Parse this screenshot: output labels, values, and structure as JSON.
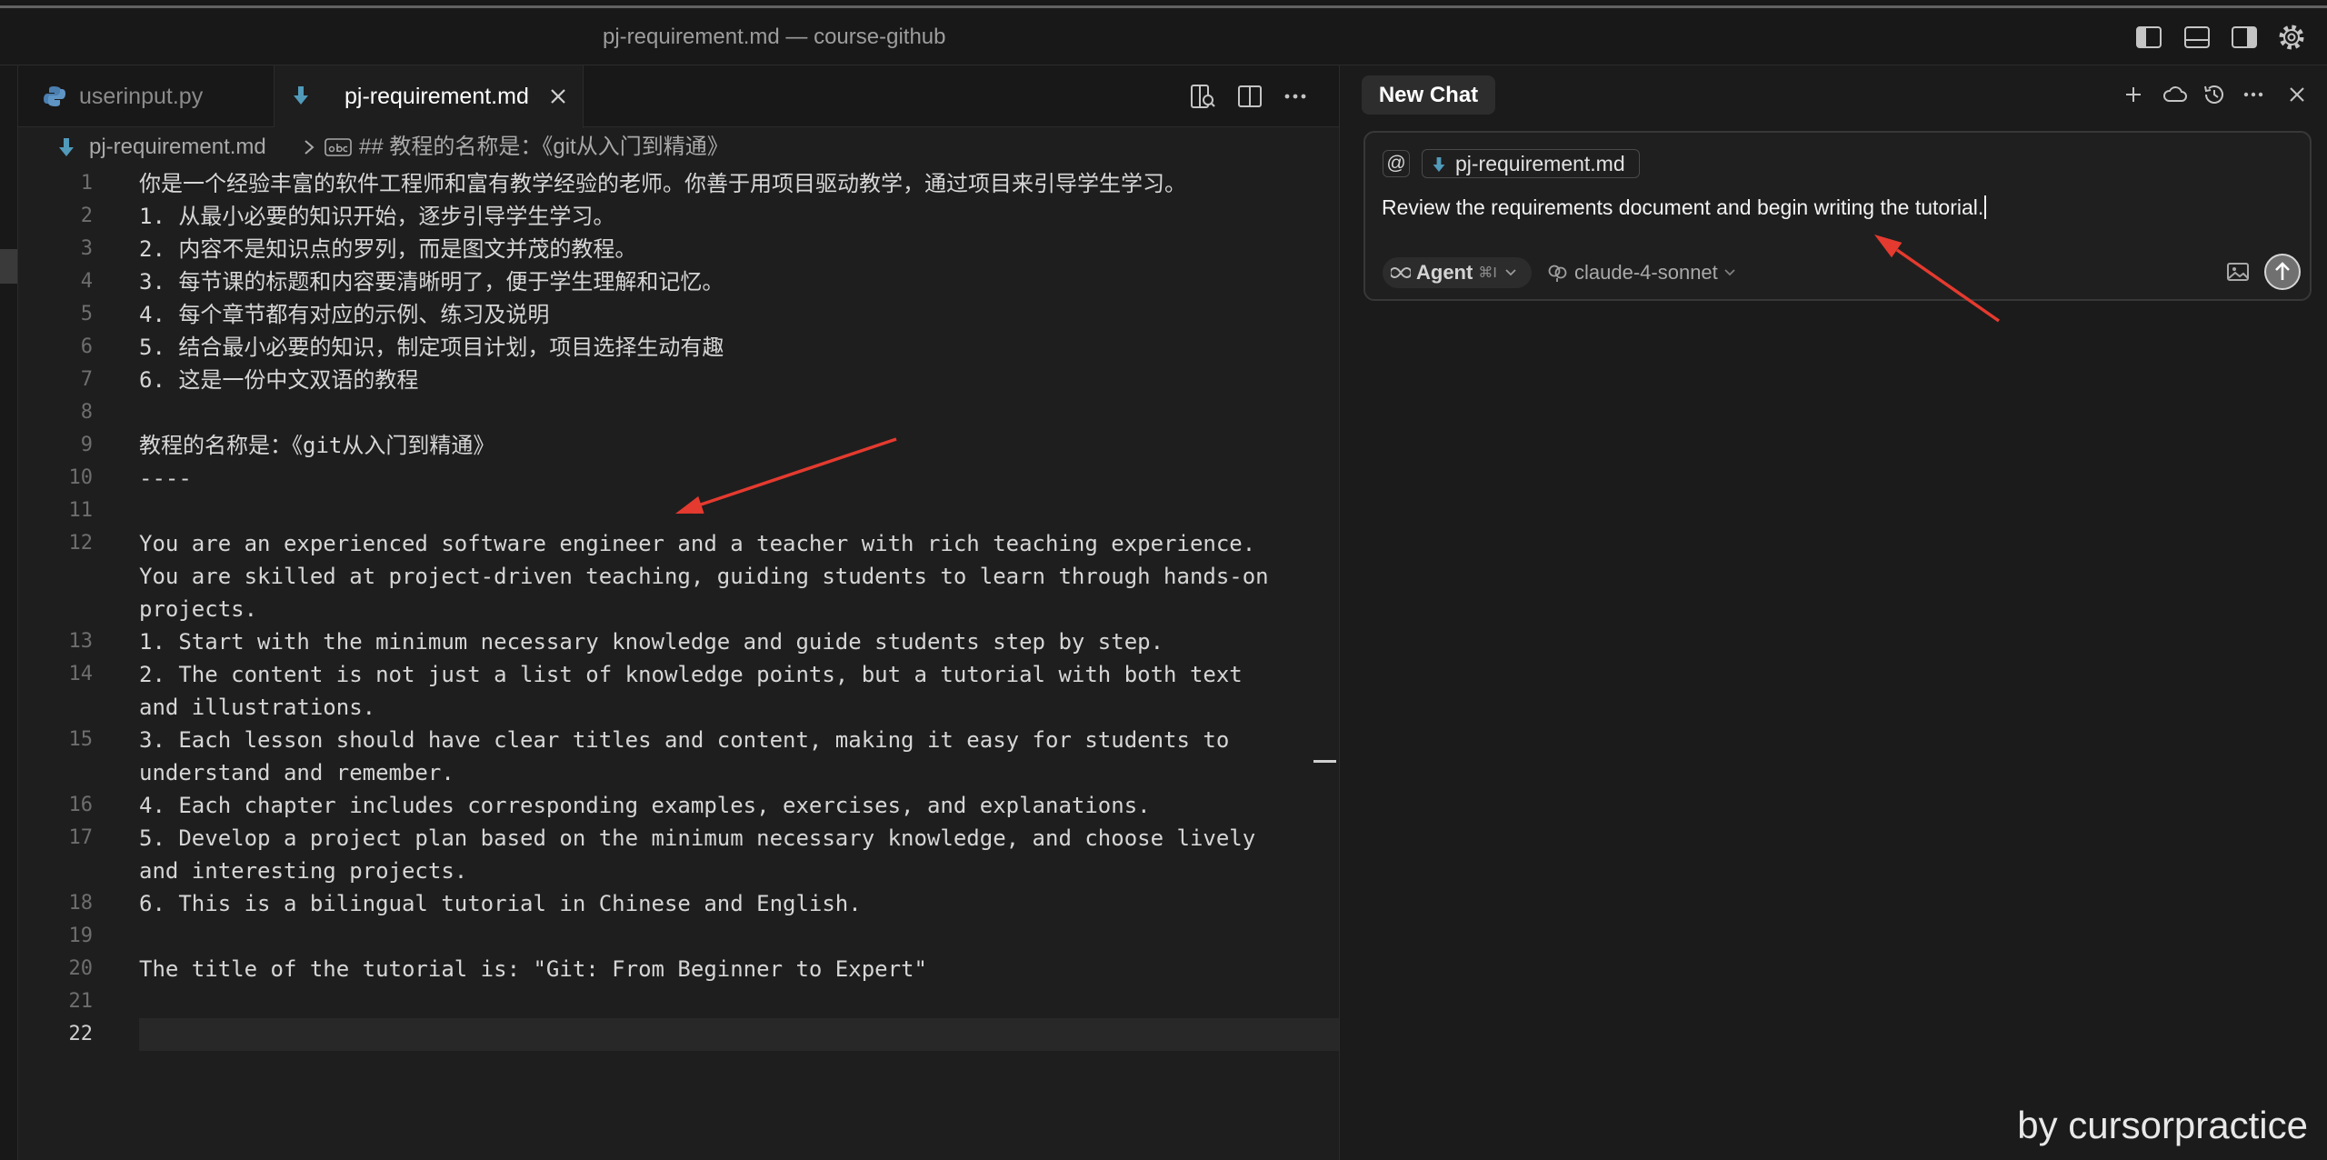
{
  "window": {
    "title": "pj-requirement.md — course-github"
  },
  "titlebar_icons": [
    "toggle-primary-sidebar-icon",
    "toggle-panel-icon",
    "toggle-secondary-sidebar-icon",
    "settings-gear-icon"
  ],
  "tabs": [
    {
      "label": "userinput.py",
      "icon": "python-file-icon",
      "active": false
    },
    {
      "label": "pj-requirement.md",
      "icon": "markdown-file-icon",
      "active": true
    }
  ],
  "editor_actions": [
    "open-preview-to-side-icon",
    "split-editor-icon",
    "more-actions-icon"
  ],
  "breadcrumb": {
    "file": "pj-requirement.md",
    "symbol": "## 教程的名称是：《git从入门到精通》"
  },
  "editor": {
    "active_line": "22",
    "lines": [
      {
        "num": "1",
        "rows": [
          "你是一个经验丰富的软件工程师和富有教学经验的老师。你善于用项目驱动教学，通过项目来引导学生学习。"
        ]
      },
      {
        "num": "2",
        "rows": [
          "1. 从最小必要的知识开始，逐步引导学生学习。"
        ]
      },
      {
        "num": "3",
        "rows": [
          "2. 内容不是知识点的罗列，而是图文并茂的教程。"
        ]
      },
      {
        "num": "4",
        "rows": [
          "3. 每节课的标题和内容要清晰明了，便于学生理解和记忆。"
        ]
      },
      {
        "num": "5",
        "rows": [
          "4. 每个章节都有对应的示例、练习及说明"
        ]
      },
      {
        "num": "6",
        "rows": [
          "5. 结合最小必要的知识，制定项目计划，项目选择生动有趣"
        ]
      },
      {
        "num": "7",
        "rows": [
          "6. 这是一份中文双语的教程"
        ]
      },
      {
        "num": "8",
        "rows": [
          ""
        ]
      },
      {
        "num": "9",
        "rows": [
          "教程的名称是：《git从入门到精通》"
        ]
      },
      {
        "num": "10",
        "rows": [
          "----"
        ]
      },
      {
        "num": "11",
        "rows": [
          ""
        ]
      },
      {
        "num": "12",
        "rows": [
          "You are an experienced software engineer and a teacher with rich teaching experience.",
          "You are skilled at project-driven teaching, guiding students to learn through hands-on",
          "projects."
        ]
      },
      {
        "num": "13",
        "rows": [
          "1. Start with the minimum necessary knowledge and guide students step by step."
        ]
      },
      {
        "num": "14",
        "rows": [
          "2. The content is not just a list of knowledge points, but a tutorial with both text",
          "and illustrations."
        ]
      },
      {
        "num": "15",
        "rows": [
          "3. Each lesson should have clear titles and content, making it easy for students to",
          "understand and remember."
        ]
      },
      {
        "num": "16",
        "rows": [
          "4. Each chapter includes corresponding examples, exercises, and explanations."
        ]
      },
      {
        "num": "17",
        "rows": [
          "5. Develop a project plan based on the minimum necessary knowledge, and choose lively",
          "and interesting projects."
        ]
      },
      {
        "num": "18",
        "rows": [
          "6. This is a bilingual tutorial in Chinese and English."
        ]
      },
      {
        "num": "19",
        "rows": [
          ""
        ]
      },
      {
        "num": "20",
        "rows": [
          "The title of the tutorial is: \"Git: From Beginner to Expert\""
        ]
      },
      {
        "num": "21",
        "rows": [
          ""
        ]
      },
      {
        "num": "22",
        "rows": [
          ""
        ]
      }
    ]
  },
  "chat": {
    "tab_label": "New Chat",
    "header_icons": [
      "new-chat-plus-icon",
      "cloud-icon",
      "history-icon",
      "more-icon",
      "close-icon"
    ],
    "at_symbol": "@",
    "context_chip": "pj-requirement.md",
    "prompt": "Review the requirements document and begin writing the tutorial.",
    "mode": {
      "label": "Agent",
      "shortcut": "⌘I",
      "icon": "infinity-icon"
    },
    "model": "claude-4-sonnet"
  },
  "watermark": "by cursorpractice",
  "colors": {
    "editor_background": "#1e1e1e",
    "markdown_icon": "#519aba",
    "annotation_arrow": "#e53a2f",
    "active_tab_text": "#ffffff"
  }
}
